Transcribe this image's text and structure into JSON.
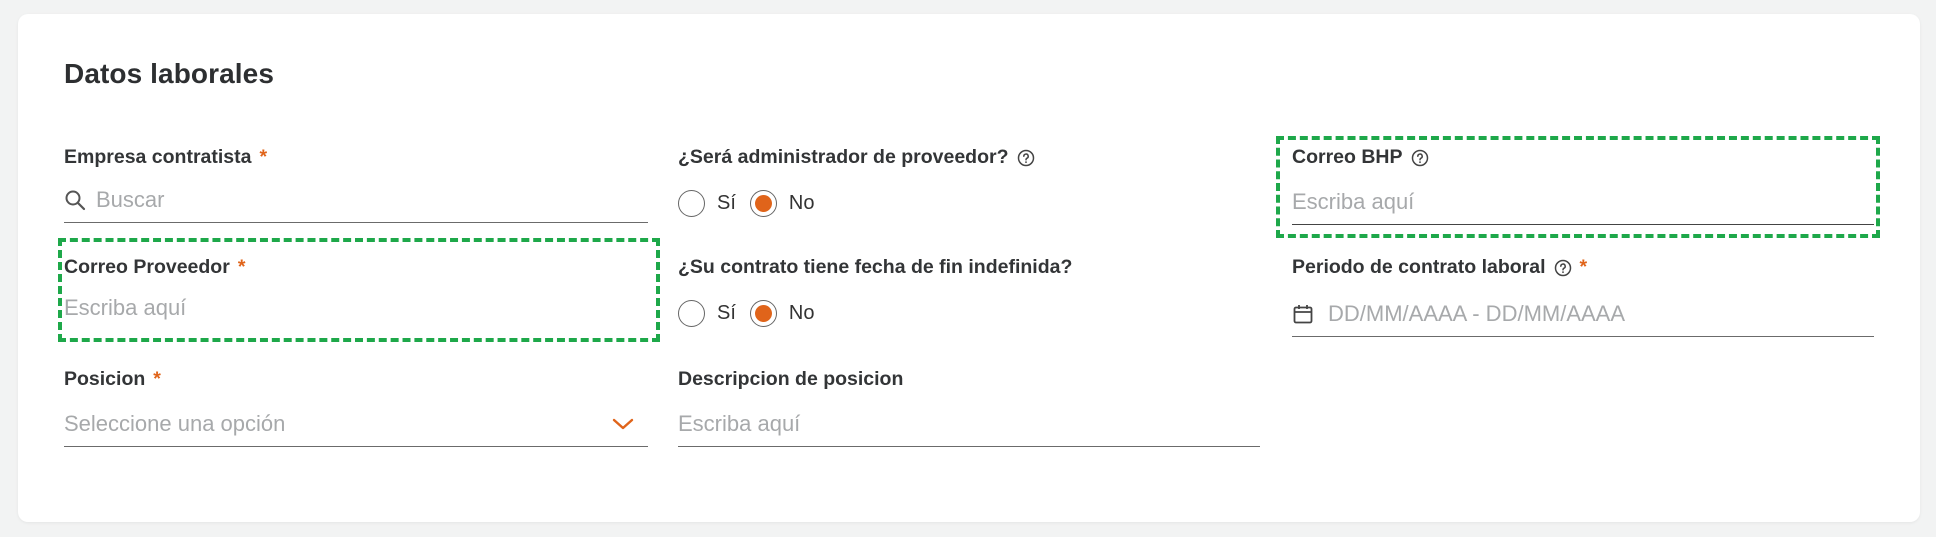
{
  "section": {
    "title": "Datos laborales"
  },
  "empresa": {
    "label": "Empresa contratista",
    "required": "*",
    "placeholder": "Buscar",
    "icon": "search-icon"
  },
  "administrador": {
    "label": "¿Será administrador de proveedor?",
    "help_icon": "help-circle-icon",
    "options": [
      "Sí",
      "No"
    ],
    "selected": "No"
  },
  "correo_bhp": {
    "label": "Correo BHP",
    "help_icon": "help-circle-icon",
    "placeholder": "Escriba aquí"
  },
  "correo_proveedor": {
    "label": "Correo Proveedor",
    "required": "*",
    "placeholder": "Escriba aquí"
  },
  "fecha_fin": {
    "label": "¿Su contrato tiene fecha de fin indefinida?",
    "options": [
      "Sí",
      "No"
    ],
    "selected": "No"
  },
  "periodo": {
    "label": "Periodo de contrato laboral",
    "help_icon": "help-circle-icon",
    "required": "*",
    "placeholder": "DD/MM/AAAA - DD/MM/AAAA",
    "icon": "calendar-icon"
  },
  "posicion": {
    "label": "Posicion",
    "required": "*",
    "placeholder": "Seleccione una opción",
    "icon": "chevron-down-icon"
  },
  "descripcion": {
    "label": "Descripcion de posicion",
    "placeholder": "Escriba aquí"
  },
  "colors": {
    "accent": "#e0641a",
    "highlight": "#1ea84a",
    "line": "#6b6b6b",
    "placeholder": "#a7a9ab"
  }
}
